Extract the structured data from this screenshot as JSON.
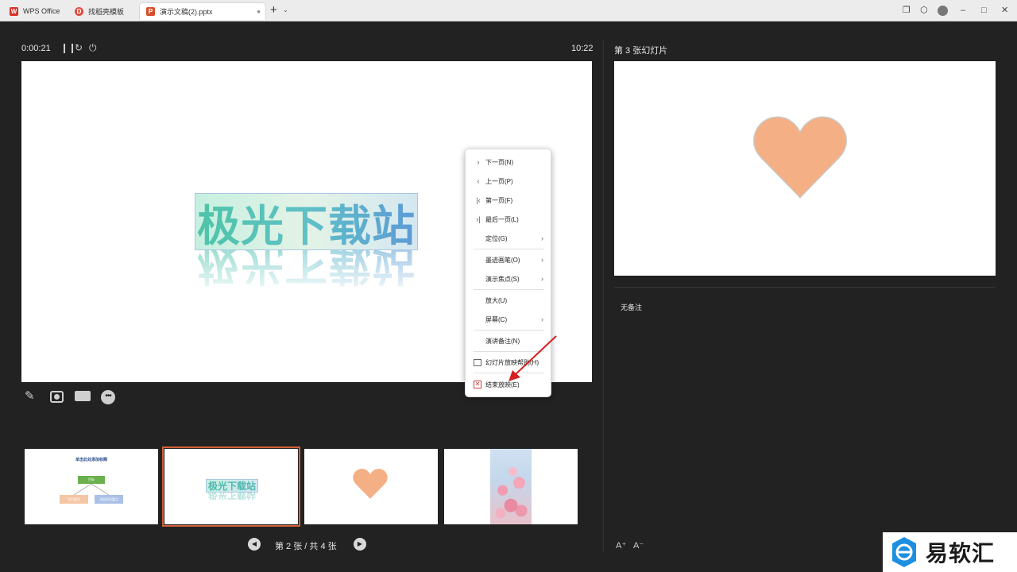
{
  "titlebar": {
    "tabs": [
      {
        "label": "WPS Office",
        "icon": "wps-logo-icon"
      },
      {
        "label": "找稻壳模板",
        "icon": "docer-icon"
      },
      {
        "label": "演示文稿(2).pptx",
        "icon": "presentation-file-icon"
      }
    ]
  },
  "presenter": {
    "elapsed_time": "0:00:21",
    "clock": "10:22",
    "current_slide_text": "极光下载站",
    "page_indicator": "第 2 张 / 共 4 张"
  },
  "context_menu": {
    "items": [
      {
        "label": "下一页(N)",
        "icon": "chevron-right-icon",
        "submenu": false
      },
      {
        "label": "上一页(P)",
        "icon": "chevron-left-icon",
        "submenu": false
      },
      {
        "label": "第一页(F)",
        "icon": "first-page-icon",
        "submenu": false
      },
      {
        "label": "最后一页(L)",
        "icon": "last-page-icon",
        "submenu": false
      },
      {
        "label": "定位(G)",
        "icon": "",
        "submenu": true
      },
      {
        "label": "墨迹画笔(O)",
        "icon": "",
        "submenu": true
      },
      {
        "label": "演示焦点(S)",
        "icon": "",
        "submenu": true
      },
      {
        "label": "放大(U)",
        "icon": "",
        "submenu": false
      },
      {
        "label": "屏幕(C)",
        "icon": "",
        "submenu": true
      },
      {
        "label": "演讲备注(N)",
        "icon": "",
        "submenu": false
      },
      {
        "label": "幻灯片放映帮助(H)",
        "icon": "help-screen-icon",
        "submenu": false
      },
      {
        "label": "结束放映(E)",
        "icon": "end-show-icon",
        "submenu": false
      }
    ]
  },
  "thumbnails": {
    "slide1": {
      "title": "单击此处添加标题",
      "box_top": "目标",
      "box_left": "项目要点",
      "box_right": "添加项目要点"
    },
    "slide2": {
      "text": "极光下载站"
    }
  },
  "right_panel": {
    "next_slide_label": "第 3 张幻灯片",
    "notes": "无备注"
  },
  "watermark": {
    "text": "易软汇"
  },
  "colors": {
    "background": "#222222",
    "selection_outline": "#d4603a",
    "heart": "#f4b084",
    "arrow": "#d42020"
  }
}
